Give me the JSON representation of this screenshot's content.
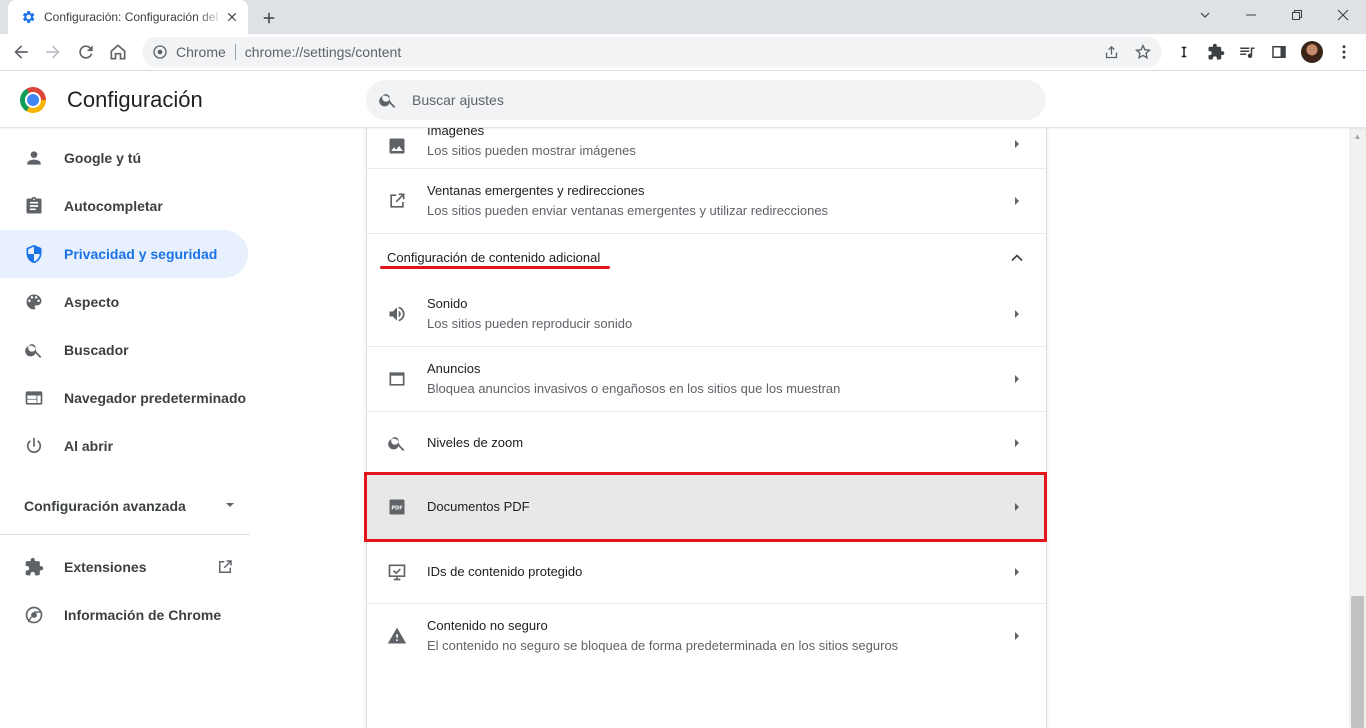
{
  "tab": {
    "title": "Configuración: Configuración del sitio"
  },
  "omnibox": {
    "chip": "Chrome",
    "url": "chrome://settings/content"
  },
  "header": {
    "title": "Configuración",
    "search_placeholder": "Buscar ajustes"
  },
  "sidebar": {
    "items": [
      {
        "label": "Google y tú",
        "icon": "person-icon"
      },
      {
        "label": "Autocompletar",
        "icon": "clipboard-icon"
      },
      {
        "label": "Privacidad y seguridad",
        "icon": "shield-icon",
        "selected": true
      },
      {
        "label": "Aspecto",
        "icon": "palette-icon"
      },
      {
        "label": "Buscador",
        "icon": "search-icon"
      },
      {
        "label": "Navegador predeterminado",
        "icon": "browser-icon"
      },
      {
        "label": "Al abrir",
        "icon": "power-icon"
      }
    ],
    "advanced": "Configuración avanzada",
    "extensions": "Extensiones",
    "about": "Información de Chrome"
  },
  "content": {
    "images": {
      "title": "Imágenes",
      "sub": "Los sitios pueden mostrar imágenes"
    },
    "popups": {
      "title": "Ventanas emergentes y redirecciones",
      "sub": "Los sitios pueden enviar ventanas emergentes y utilizar redirecciones"
    },
    "additional_header": "Configuración de contenido adicional",
    "sound": {
      "title": "Sonido",
      "sub": "Los sitios pueden reproducir sonido"
    },
    "ads": {
      "title": "Anuncios",
      "sub": "Bloquea anuncios invasivos o engañosos en los sitios que los muestran"
    },
    "zoom": {
      "title": "Niveles de zoom"
    },
    "pdf": {
      "title": "Documentos PDF"
    },
    "protected": {
      "title": "IDs de contenido protegido"
    },
    "insecure": {
      "title": "Contenido no seguro",
      "sub": "El contenido no seguro se bloquea de forma predeterminada en los sitios seguros"
    }
  },
  "colors": {
    "accent": "#1a73e8",
    "annotation": "#e3141c",
    "selected_bg": "#e8f0fe"
  }
}
